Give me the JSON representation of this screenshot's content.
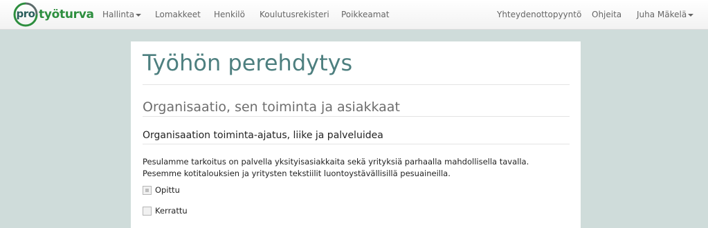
{
  "brand": {
    "prefix": "pro",
    "name": "työturva"
  },
  "nav": {
    "left": [
      {
        "label": "Hallinta",
        "dropdown": true
      },
      {
        "label": "Lomakkeet"
      },
      {
        "label": "Henkilö"
      },
      {
        "label": "Koulutusrekisteri"
      },
      {
        "label": "Poikkeamat"
      }
    ],
    "right": [
      {
        "label": "Yhteydenottopyyntö"
      },
      {
        "label": "Ohjeita"
      },
      {
        "label": "Juha Mäkelä",
        "dropdown": true
      }
    ]
  },
  "page": {
    "title": "Työhön perehdytys",
    "section_title": "Organisaatio, sen toiminta ja asiakkaat",
    "subsection_title": "Organisaation toiminta-ajatus, liike ja palveluidea",
    "paragraph": "Pesulamme tarkoitus on palvella yksityisasiakkaita sekä yrityksiä parhaalla mahdollisella tavalla. Pesemme kotitalouksien ja yritysten tekstiilit luontoystävällisillä pesuaineilla.",
    "checkboxes": [
      {
        "label": "Opittu",
        "checked": true
      },
      {
        "label": "Kerrattu",
        "checked": false
      }
    ]
  },
  "colors": {
    "background": "#cfdcda",
    "title": "#4d7f7f",
    "brand_green": "#2d8e3e"
  }
}
